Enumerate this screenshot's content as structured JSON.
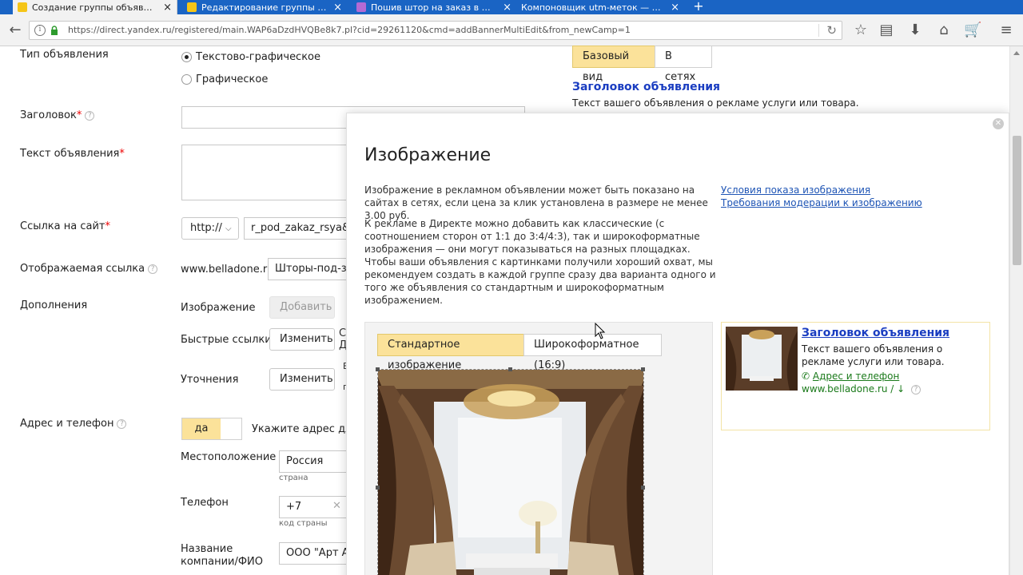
{
  "browser": {
    "tabs": [
      {
        "title": "Создание группы объявлен...",
        "active": true
      },
      {
        "title": "Редактирование группы об...",
        "active": false
      },
      {
        "title": "Пошив штор на заказ в Мос...",
        "active": false
      },
      {
        "title": "Компоновщик utm-меток — гене...",
        "active": false
      }
    ],
    "new_tab": "+",
    "url": "https://direct.yandex.ru/registered/main.WAP6aDzdHVQBe8k7.pl?cid=29261120&cmd=addBannerMultiEdit&from_newCamp=1"
  },
  "form": {
    "ad_type_label": "Тип объявления",
    "ad_type_options": [
      "Текстово-графическое",
      "Графическое"
    ],
    "headline_label": "Заголовок",
    "text_label": "Текст объявления",
    "link_label": "Ссылка на сайт",
    "protocol": "http://",
    "link_value": "r_pod_zakaz_rsya&ty",
    "display_link_label": "Отображаемая ссылка",
    "display_domain": "www.belladone.ru/",
    "display_path": "Шторы-под-зака",
    "extras_label": "Дополнения",
    "image_label": "Изображение",
    "add_button": "Добавить",
    "quick_links_label": "Быстрые ссылки",
    "change_button": "Изменить",
    "refinements_label": "Уточнения",
    "address_label": "Адрес и телефон",
    "yes_toggle": "да",
    "address_hint": "Укажите адрес для",
    "location_label": "Местоположение",
    "country_value": "Россия",
    "country_sub": "страна",
    "phone_label": "Телефон",
    "phone_code": "+7",
    "phone_sub": "код страны",
    "company_label_1": "Название",
    "company_label_2": "компании/ФИО",
    "company_value": "ООО \"Арт А"
  },
  "preview": {
    "tabs": [
      "Базовый вид",
      "В сетях"
    ],
    "headline": "Заголовок объявления",
    "text": "Текст вашего объявления о рекламе услуги или товара."
  },
  "modal": {
    "title": "Изображение",
    "para1": "Изображение в рекламном объявлении может быть показано на сайтах в сетях, если цена за клик установлена в размере не менее 3.00 руб.",
    "para2": "К рекламе в Директе можно добавить как классические (с соотношением сторон от 1:1 до 3:4/4:3), так и широкоформатные изображения — они могут показываться на разных площадках. Чтобы ваши объявления с картинками получили хороший охват, мы рекомендуем создать в каждой группе сразу два варианта одного и того же объявления со стандартным и широкоформатным изображением.",
    "link_conditions": "Условия показа изображения",
    "link_requirements": "Требования модерации к изображению",
    "tabs": [
      "Стандартное изображение",
      "Широкоформатное (16:9)"
    ],
    "ad_preview": {
      "headline": "Заголовок объявления",
      "text": "Текст вашего объявления о рекламе услуги или товара.",
      "address_link": "Адрес и телефон",
      "domain": "www.belladone.ru /"
    }
  },
  "colors": {
    "tab_bar": "#1a64c4",
    "accent_yellow": "#fbe29a",
    "link_blue": "#1f55b5",
    "green_url": "#1b7a1b"
  }
}
